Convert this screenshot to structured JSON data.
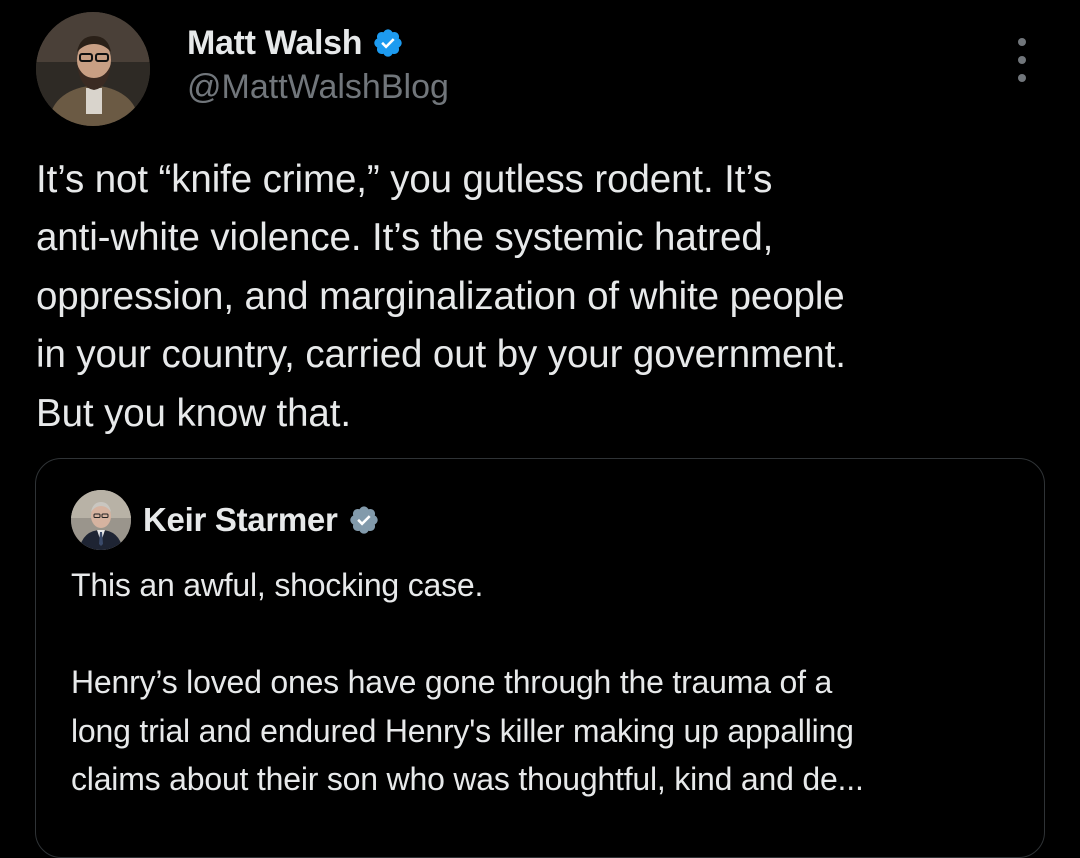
{
  "theme": {
    "background": "#000000",
    "text": "#e7e9ea",
    "secondary_text": "#71767b",
    "verified_blue": "#1d9bf0",
    "verified_gray": "#829aab",
    "border": "#2f3336"
  },
  "tweet": {
    "author": {
      "name": "Matt Walsh",
      "handle": "@MattWalshBlog",
      "verified": true,
      "avatar_icon": "profile-photo"
    },
    "more_icon": "more-options-icon",
    "text": "It’s not “knife crime,” you gutless rodent. It’s\nanti-white violence. It’s the systemic hatred,\noppression, and marginalization of white people\nin your country, carried out by your government.\nBut you know that.",
    "quoted_tweet": {
      "author": {
        "name": "Keir Starmer",
        "verified": true,
        "verified_type": "government-gray",
        "avatar_icon": "profile-photo"
      },
      "text": "This an awful, shocking case.\n\nHenry’s loved ones have gone through the trauma of a\nlong trial and endured Henry's killer making up appalling\nclaims about their son who was thoughtful, kind and de..."
    }
  }
}
